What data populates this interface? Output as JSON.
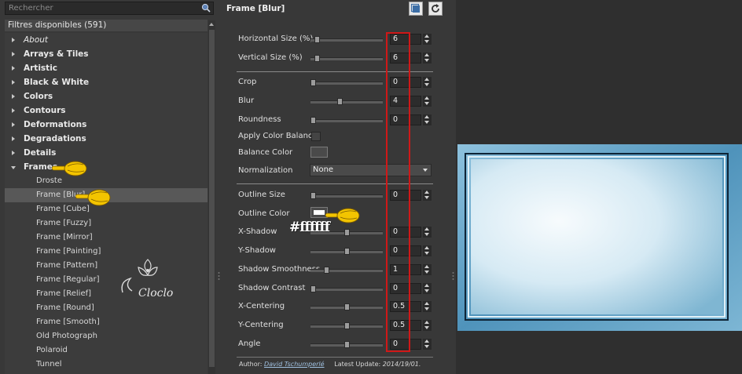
{
  "search": {
    "placeholder": "Rechercher"
  },
  "filters_header": "Filtres disponibles (591)",
  "categories": [
    {
      "label": "About",
      "italic": true
    },
    {
      "label": "Arrays & Tiles"
    },
    {
      "label": "Artistic"
    },
    {
      "label": "Black & White"
    },
    {
      "label": "Colors"
    },
    {
      "label": "Contours"
    },
    {
      "label": "Deformations"
    },
    {
      "label": "Degradations"
    },
    {
      "label": "Details"
    },
    {
      "label": "Frames",
      "expanded": true
    }
  ],
  "frames_items": [
    "Droste",
    "Frame [Blur]",
    "Frame [Cube]",
    "Frame [Fuzzy]",
    "Frame [Mirror]",
    "Frame [Painting]",
    "Frame [Pattern]",
    "Frame [Regular]",
    "Frame [Relief]",
    "Frame [Round]",
    "Frame [Smooth]",
    "Old Photograph",
    "Polaroid",
    "Tunnel"
  ],
  "selected_filter": "Frame [Blur]",
  "panel": {
    "title": "Frame [Blur]",
    "params": {
      "horizontal_size": {
        "label": "Horizontal Size (%)",
        "value": "6",
        "level": 0.06
      },
      "vertical_size": {
        "label": "Vertical Size (%)",
        "value": "6",
        "level": 0.06
      },
      "crop": {
        "label": "Crop",
        "value": "0",
        "level": 0
      },
      "blur": {
        "label": "Blur",
        "value": "4",
        "level": 0.4
      },
      "roundness": {
        "label": "Roundness",
        "value": "0",
        "level": 0
      },
      "apply_color_balance": {
        "label": "Apply Color Balance"
      },
      "balance_color": {
        "label": "Balance Color",
        "color": "#4a4a4a"
      },
      "normalization": {
        "label": "Normalization",
        "value": "None"
      },
      "outline_size": {
        "label": "Outline Size",
        "value": "0",
        "level": 0
      },
      "outline_color": {
        "label": "Outline Color",
        "color": "#ffffff"
      },
      "x_shadow": {
        "label": "X-Shadow",
        "value": "0",
        "level": 0.5
      },
      "y_shadow": {
        "label": "Y-Shadow",
        "value": "0",
        "level": 0.5
      },
      "shadow_smoothness": {
        "label": "Shadow Smoothness",
        "value": "1",
        "level": 0.2
      },
      "shadow_contrast": {
        "label": "Shadow Contrast",
        "value": "0",
        "level": 0
      },
      "x_centering": {
        "label": "X-Centering",
        "value": "0.5",
        "level": 0.5
      },
      "y_centering": {
        "label": "Y-Centering",
        "value": "0.5",
        "level": 0.5
      },
      "angle": {
        "label": "Angle",
        "value": "0",
        "level": 0.5
      }
    },
    "hex_annotation": "#ffffff",
    "footer": {
      "author_label": "Author:",
      "author_name": "David Tschumperlé",
      "update_label": "Latest Update:",
      "update_date": "2014/19/01."
    }
  },
  "watermark_text": "Cloclo",
  "colors": {
    "accent_red": "#d01818",
    "hand": "#f3c400",
    "preview_frame": "#5fa3c8"
  }
}
